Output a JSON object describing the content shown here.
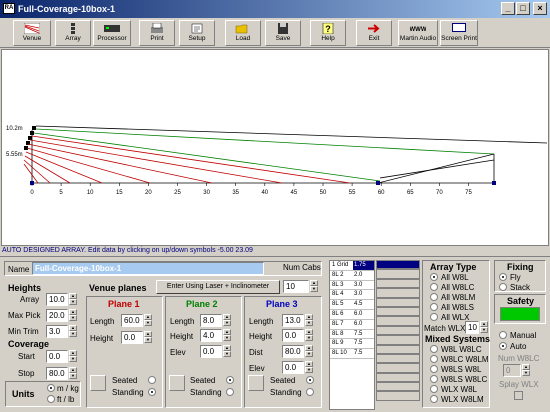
{
  "window": {
    "title": "Full-Coverage-10box-1",
    "icon": "RA"
  },
  "toolbar": [
    {
      "label": "Venue",
      "icon": "venue-icon"
    },
    {
      "label": "Array",
      "icon": "array-icon"
    },
    {
      "label": "Processor",
      "icon": "processor-icon"
    },
    {
      "label": "Print",
      "icon": "print-icon"
    },
    {
      "label": "Setup",
      "icon": "setup-icon"
    },
    {
      "label": "Load",
      "icon": "load-icon"
    },
    {
      "label": "Save",
      "icon": "save-icon"
    },
    {
      "label": "Help",
      "icon": "help-icon"
    },
    {
      "label": "Exit",
      "icon": "exit-icon"
    },
    {
      "label": "Martin Audio",
      "icon": "martin-audio-icon"
    },
    {
      "label": "Screen Print",
      "icon": "screen-print-icon"
    }
  ],
  "plot": {
    "y_labels": [
      "10.2m",
      "5.55m"
    ],
    "x_ticks": [
      "0",
      "5",
      "10",
      "15",
      "20",
      "25",
      "30",
      "35",
      "40",
      "45",
      "50",
      "55",
      "60",
      "65",
      "70",
      "75"
    ]
  },
  "status": "AUTO DESIGNED ARRAY. Edit data by clicking on up/down symbols   -5.00  23.09",
  "name": {
    "label": "Name",
    "value": "Full-Coverage-10box-1"
  },
  "num_cabs": {
    "label": "Num Cabs",
    "value": "10"
  },
  "heights": {
    "title": "Heights",
    "array_label": "Array",
    "array": "10.0",
    "maxpick_label": "Max Pick",
    "maxpick": "20.0",
    "mintrim_label": "Min Trim",
    "mintrim": "3.0"
  },
  "coverage": {
    "title": "Coverage",
    "start_label": "Start",
    "start": "0.0",
    "stop_label": "Stop",
    "stop": "80.0"
  },
  "units": {
    "title": "Units",
    "opt1": "m / kg",
    "opt2": "ft / lb"
  },
  "venue_planes": {
    "title": "Venue planes",
    "laser_button": "Enter Using Laser + Inclinometer"
  },
  "plane1": {
    "title": "Plane 1",
    "length_label": "Length",
    "length": "60.0",
    "height_label": "Height",
    "height": "0.0",
    "seated": "Seated",
    "standing": "Standing"
  },
  "plane2": {
    "title": "Plane 2",
    "length_label": "Length",
    "length": "8.0",
    "height_label": "Height",
    "height": "4.0",
    "elev_label": "Elev",
    "elev": "0.0",
    "seated": "Seated",
    "standing": "Standing"
  },
  "plane3": {
    "title": "Plane 3",
    "length_label": "Length",
    "length": "13.0",
    "height_label": "Height",
    "height": "0.0",
    "dist_label": "Dist",
    "dist": "80.0",
    "elev_label": "Elev",
    "elev": "0.0",
    "seated": "Seated",
    "standing": "Standing"
  },
  "cab_grid": [
    [
      "1 Grid",
      "1.75"
    ],
    [
      "8L 2",
      "2.0"
    ],
    [
      "8L 3",
      "3.0"
    ],
    [
      "8L 4",
      "3.0"
    ],
    [
      "8L 5",
      "4.5"
    ],
    [
      "8L 6",
      "6.0"
    ],
    [
      "8L 7",
      "6.0"
    ],
    [
      "8L 8",
      "7.5"
    ],
    [
      "8L 9",
      "7.5"
    ],
    [
      "8L 10",
      "7.5"
    ]
  ],
  "array_type": {
    "title": "Array Type",
    "options": [
      "All W8L",
      "All W8LC",
      "All W8LM",
      "All W8LS",
      "All WLX"
    ],
    "selected": 0,
    "match_label": "Match WLX",
    "match_value": "10"
  },
  "mixed_systems": {
    "title": "Mixed Systems",
    "options": [
      "W8L W8LC",
      "W8LC W8LM",
      "W8LS W8L",
      "W8LS W8LC",
      "WLX W8L",
      "WLX W8LM"
    ]
  },
  "fixing": {
    "title": "Fixing",
    "fly": "Fly",
    "stack": "Stack"
  },
  "safety": {
    "title": "Safety",
    "color": "#00c800"
  },
  "mode": {
    "manual": "Manual",
    "auto": "Auto",
    "num_label": "Num W8LC",
    "num_value": "0",
    "splay_label": "Splay WLX"
  }
}
